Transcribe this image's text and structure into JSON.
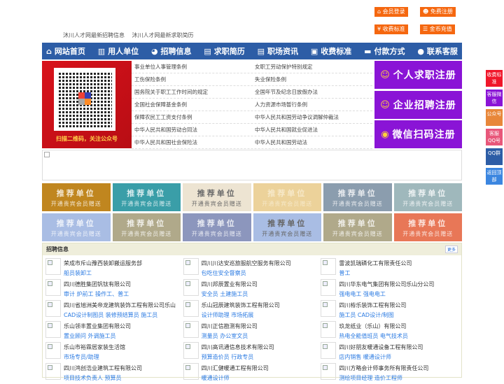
{
  "top_buttons": [
    {
      "label": "会员登录",
      "icon": "home-icon"
    },
    {
      "label": "免费注册",
      "icon": "user-add-icon"
    },
    {
      "label": "收费标准",
      "icon": "yen-icon"
    },
    {
      "label": "金币充值",
      "icon": "coins-icon"
    }
  ],
  "top_links": [
    "沐川人才网最新招聘信息",
    "沐川人才网最新求职简历"
  ],
  "nav": [
    {
      "label": "网站首页",
      "icon": "home-icon"
    },
    {
      "label": "用人单位",
      "icon": "building-icon"
    },
    {
      "label": "招聘信息",
      "icon": "chat-icon"
    },
    {
      "label": "求职简历",
      "icon": "resume-icon"
    },
    {
      "label": "职场资讯",
      "icon": "news-icon"
    },
    {
      "label": "收费标准",
      "icon": "fee-icon"
    },
    {
      "label": "付款方式",
      "icon": "card-icon"
    },
    {
      "label": "联系客服",
      "icon": "phone-icon"
    }
  ],
  "qr": {
    "caption": "扫描二维码，关注公众号"
  },
  "law_links": [
    [
      "事业单位人事管理条例",
      "女职工劳动保护特别规定"
    ],
    [
      "工伤保险条例",
      "失业保险条例"
    ],
    [
      "国务院关于职工工作时间的规定",
      "全国年节及纪念日放假办法"
    ],
    [
      "全国社会保障基金条例",
      "人力资源市场暂行条例"
    ],
    [
      "保障农民工工资支付条例",
      "中华人民共和国劳动争议调解仲裁法"
    ],
    [
      "中华人民共和国劳动合同法",
      "中华人民共和国就业促进法"
    ],
    [
      "中华人民共和国社会保险法",
      "中华人民共和国劳动法"
    ]
  ],
  "register": [
    {
      "label": "个人求职注册",
      "icon": "person-add-icon"
    },
    {
      "label": "企业招聘注册",
      "icon": "company-icon"
    },
    {
      "label": "微信扫码注册",
      "icon": "wechat-icon"
    }
  ],
  "tiles": {
    "title": "推荐单位",
    "subtitle": "开通贵宾会员赠送",
    "colors": [
      "#c0861f",
      "#3a9ea8",
      "#ede4d2",
      "#ecd29a",
      "#8b9dae",
      "#9fb8bc",
      "#a9bde4",
      "#b0a98a",
      "#8c96bd",
      "#a9bde4",
      "#b0a98a",
      "#e87757"
    ]
  },
  "recruit": {
    "title": "招聘信息",
    "more": "更多",
    "jobs": [
      {
        "company": "荣成市斥山豫西装卸搬运服务部",
        "positions": "船员装卸工"
      },
      {
        "company": "四川川达安巡旅服航空服务有限公司",
        "positions": "包吃住安全督察员"
      },
      {
        "company": "雷波凯瑞磷化工有限责任公司",
        "positions": "普工"
      },
      {
        "company": "四川德胜集团钒钛有限公司",
        "positions": "审计 炉前工 操作工、普工"
      },
      {
        "company": "四川邦辰置业有限公司",
        "positions": "安全员 土建施工员"
      },
      {
        "company": "四川华东电气集团有限公司乐山分公司",
        "positions": "强电电工 强电电工"
      },
      {
        "company": "四川省旭洲美帝龙建筑装饰工程有限公司乐山",
        "positions": "CAD设计制图员 装修预结算员 施工员"
      },
      {
        "company": "乐山冠辰建筑装饰工程有限公司",
        "positions": "设计师助理 市场拓展"
      },
      {
        "company": "四川栫乐装饰工程有限公司",
        "positions": "施工员 CAD设计/制图"
      },
      {
        "company": "乐山领丰置业集团有限公司",
        "positions": "置业顾问 外调施工员"
      },
      {
        "company": "四川正信勘测有限公司",
        "positions": "测量员 办公室文员"
      },
      {
        "company": "玖龙纸业（乐山）有限公司",
        "positions": "热电全能值班员 电气技术员"
      },
      {
        "company": "乐山市裕霖居家装生活馆",
        "positions": "市场专员/助理"
      },
      {
        "company": "四川高讯通信息技术有限公司",
        "positions": "预算造价员 行政专员"
      },
      {
        "company": "四川好朋友暖通设备工程有限公司",
        "positions": "店内销售 暖通设计师"
      },
      {
        "company": "四川鸿创浩业建筑工程有限公司",
        "positions": "项目技术负责人 预算员"
      },
      {
        "company": "四川汇健暖通工程有限公司",
        "positions": "暖通设计师"
      },
      {
        "company": "四川方略会计师事务所有限责任公司",
        "positions": "测绘项目经理 造价工程师"
      }
    ]
  },
  "side": [
    {
      "label": "收费标准",
      "color": "#f0162a"
    },
    {
      "label": "客服微信",
      "color": "#8a14d6"
    },
    {
      "label": "公众号",
      "color": "#e8873a"
    },
    {
      "label": "客服QQ号",
      "color": "#e8577a"
    },
    {
      "label": "QQ群",
      "color": "#2d5da6"
    },
    {
      "label": "返回顶部",
      "color": "#3b86e0"
    }
  ]
}
